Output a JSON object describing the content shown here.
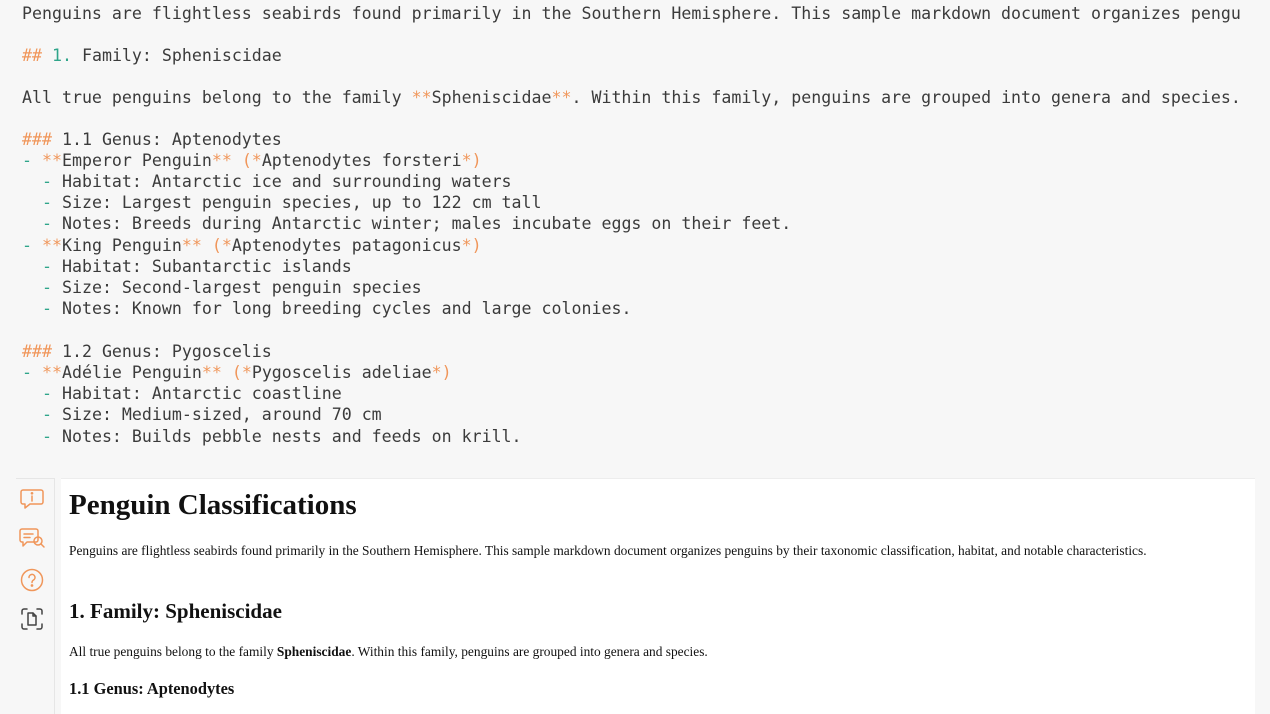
{
  "editor": {
    "intro": "Penguins are flightless seabirds found primarily in the Southern Hemisphere. This sample markdown document organizes pengu",
    "family_heading_mark": "##",
    "family_heading_num": "1.",
    "family_heading_text": "Family: Spheniscidae",
    "family_para_a": "All true penguins belong to the family ",
    "bold_mark": "**",
    "family_para_bold": "Spheniscidae",
    "family_para_b": ". Within this family, penguins are grouped into genera and species.",
    "h3_mark": "###",
    "genus1_heading": "1.1 Genus: Aptenodytes",
    "dash": "-",
    "emperor_name": "Emperor Penguin",
    "emperor_sci": "Aptenodytes forsteri",
    "emperor_habitat": "Habitat: Antarctic ice and surrounding waters",
    "emperor_size": "Size: Largest penguin species, up to 122 cm tall",
    "emperor_notes": "Notes: Breeds during Antarctic winter; males incubate eggs on their feet.",
    "king_name": "King Penguin",
    "king_sci": "Aptenodytes patagonicus",
    "king_habitat": "Habitat: Subantarctic islands",
    "king_size": "Size: Second-largest penguin species",
    "king_notes": "Notes: Known for long breeding cycles and large colonies.",
    "genus2_heading": "1.2 Genus: Pygoscelis",
    "adelie_name": "Adélie Penguin",
    "adelie_sci": "Pygoscelis adeliae",
    "adelie_habitat": "Habitat: Antarctic coastline",
    "adelie_size": "Size: Medium-sized, around 70 cm",
    "adelie_notes": "Notes: Builds pebble nests and feeds on krill.",
    "open_paren_star": " (*",
    "close_star_paren": "*)"
  },
  "toolbar": {
    "icons": [
      "info-comment-icon",
      "chat-search-icon",
      "help-icon",
      "document-scan-icon"
    ],
    "accent": "#f0965a"
  },
  "preview": {
    "title": "Penguin Classifications",
    "intro": "Penguins are flightless seabirds found primarily in the Southern Hemisphere. This sample markdown document organizes penguins by their taxonomic classification, habitat, and notable characteristics.",
    "family_heading": "1. Family: Spheniscidae",
    "family_para_a": "All true penguins belong to the family ",
    "family_para_bold": "Spheniscidae",
    "family_para_b": ". Within this family, penguins are grouped into genera and species.",
    "genus1_heading": "1.1 Genus: Aptenodytes"
  }
}
